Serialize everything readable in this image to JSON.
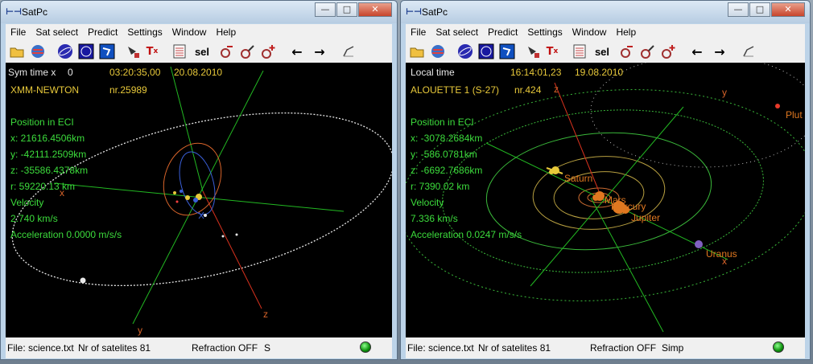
{
  "windows": [
    {
      "title": "SatPc",
      "menu": [
        "File",
        "Sat select",
        "Predict",
        "Settings",
        "Window",
        "Help"
      ],
      "sel_label": "sel",
      "time_label": "Sym time x",
      "time_mult": "0",
      "time": "03:20:35,00",
      "date": "20.08.2010",
      "satellite": "XMM-NEWTON",
      "sat_nr": "nr.25989",
      "pos_title": "Position in ECI",
      "x": "x: 21616.4506km",
      "y": "y: -42111.2509km",
      "z": "z: -35586.4378km",
      "r": "r: 59220.13 km",
      "velocity_title": "Velocity",
      "velocity": "2.740 km/s",
      "acceleration": "Acceleration 0.0000 m/s/s",
      "axis_x": "x",
      "axis_y": "y",
      "axis_z": "z",
      "status_file": "File: science.txt",
      "status_nr": "Nr of satelites 81",
      "status_refraction": "Refraction OFF",
      "status_extra": "S"
    },
    {
      "title": "SatPc",
      "menu": [
        "File",
        "Sat select",
        "Predict",
        "Settings",
        "Window",
        "Help"
      ],
      "sel_label": "sel",
      "time_label": "Local time",
      "time": "16:14:01,23",
      "date": "19.08.2010",
      "satellite": "ALOUETTE 1 (S-27)",
      "sat_nr": "nr.424",
      "pos_title": "Position in ECI",
      "x": "x: -3078.2684km",
      "y": "y: -586.0781km",
      "z": "z: -6692.7686km",
      "r": "r: 7390.02 km",
      "velocity_title": "Velocity",
      "velocity": "7.336 km/s",
      "acceleration": "Acceleration 0.0247 m/s/s",
      "axis_x": "x",
      "axis_y": "y",
      "axis_z": "z",
      "planets": {
        "saturn": "Saturn",
        "mars": "Mars",
        "mercury": "Mercury",
        "jupiter": "Jupiter",
        "uranus": "Uranus",
        "pluto": "Plut"
      },
      "status_file": "File: science.txt",
      "status_nr": "Nr of satelites 81",
      "status_refraction": "Refraction OFF",
      "status_extra": "Simp"
    }
  ],
  "colors": {
    "info_green": "#3cdc3c",
    "info_yellow": "#e8c93a",
    "axis_green": "#22b822",
    "axis_red": "#d8321e",
    "orbit_white": "#e8e8e8",
    "planet_orange": "#e07820"
  },
  "toolbar_icons": [
    "open-folder-icon",
    "globe-icon",
    "satellite-orbit-icon",
    "star-map-icon",
    "world-map-icon",
    "antenna-icon",
    "tx-icon",
    "list-icon",
    "sel-button",
    "remove-sat-icon",
    "edit-sat-icon",
    "add-sat-icon",
    "arrow-left-icon",
    "arrow-right-icon",
    "sweep-icon"
  ]
}
